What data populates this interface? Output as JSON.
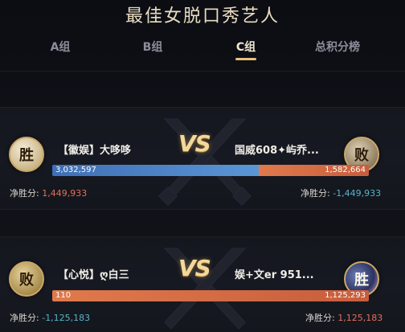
{
  "title": "最佳女脱口秀艺人",
  "tabs": [
    {
      "label": "A组",
      "active": false
    },
    {
      "label": "B组",
      "active": false
    },
    {
      "label": "C组",
      "active": true
    },
    {
      "label": "总积分榜",
      "active": false
    }
  ],
  "matches": [
    {
      "left": {
        "name": "【徽娱】大哆哆",
        "badge": "胜",
        "score": "3,032,597",
        "net_label": "净胜分:",
        "net_value": "1,449,933"
      },
      "right": {
        "name": "国威608✦屿乔...",
        "badge": "败",
        "score": "1,582,664",
        "net_label": "净胜分:",
        "net_value": "-1,449,933"
      },
      "vs": "VS",
      "left_share": 0.657
    },
    {
      "left": {
        "name": "【心悦】ღ白三",
        "badge": "败",
        "score": "110",
        "net_label": "净胜分:",
        "net_value": "-1,125,183"
      },
      "right": {
        "name": "娱+文er 951...",
        "badge": "胜",
        "score": "1,125,293",
        "net_label": "净胜分:",
        "net_value": "1,125,183"
      },
      "vs": "VS",
      "left_share": 0.0001
    }
  ],
  "colors": {
    "accent": "#e8c07a",
    "left_bar": "#4a80c4",
    "right_bar": "#d56b45",
    "positive": "#e07158",
    "negative": "#54b5c9"
  }
}
